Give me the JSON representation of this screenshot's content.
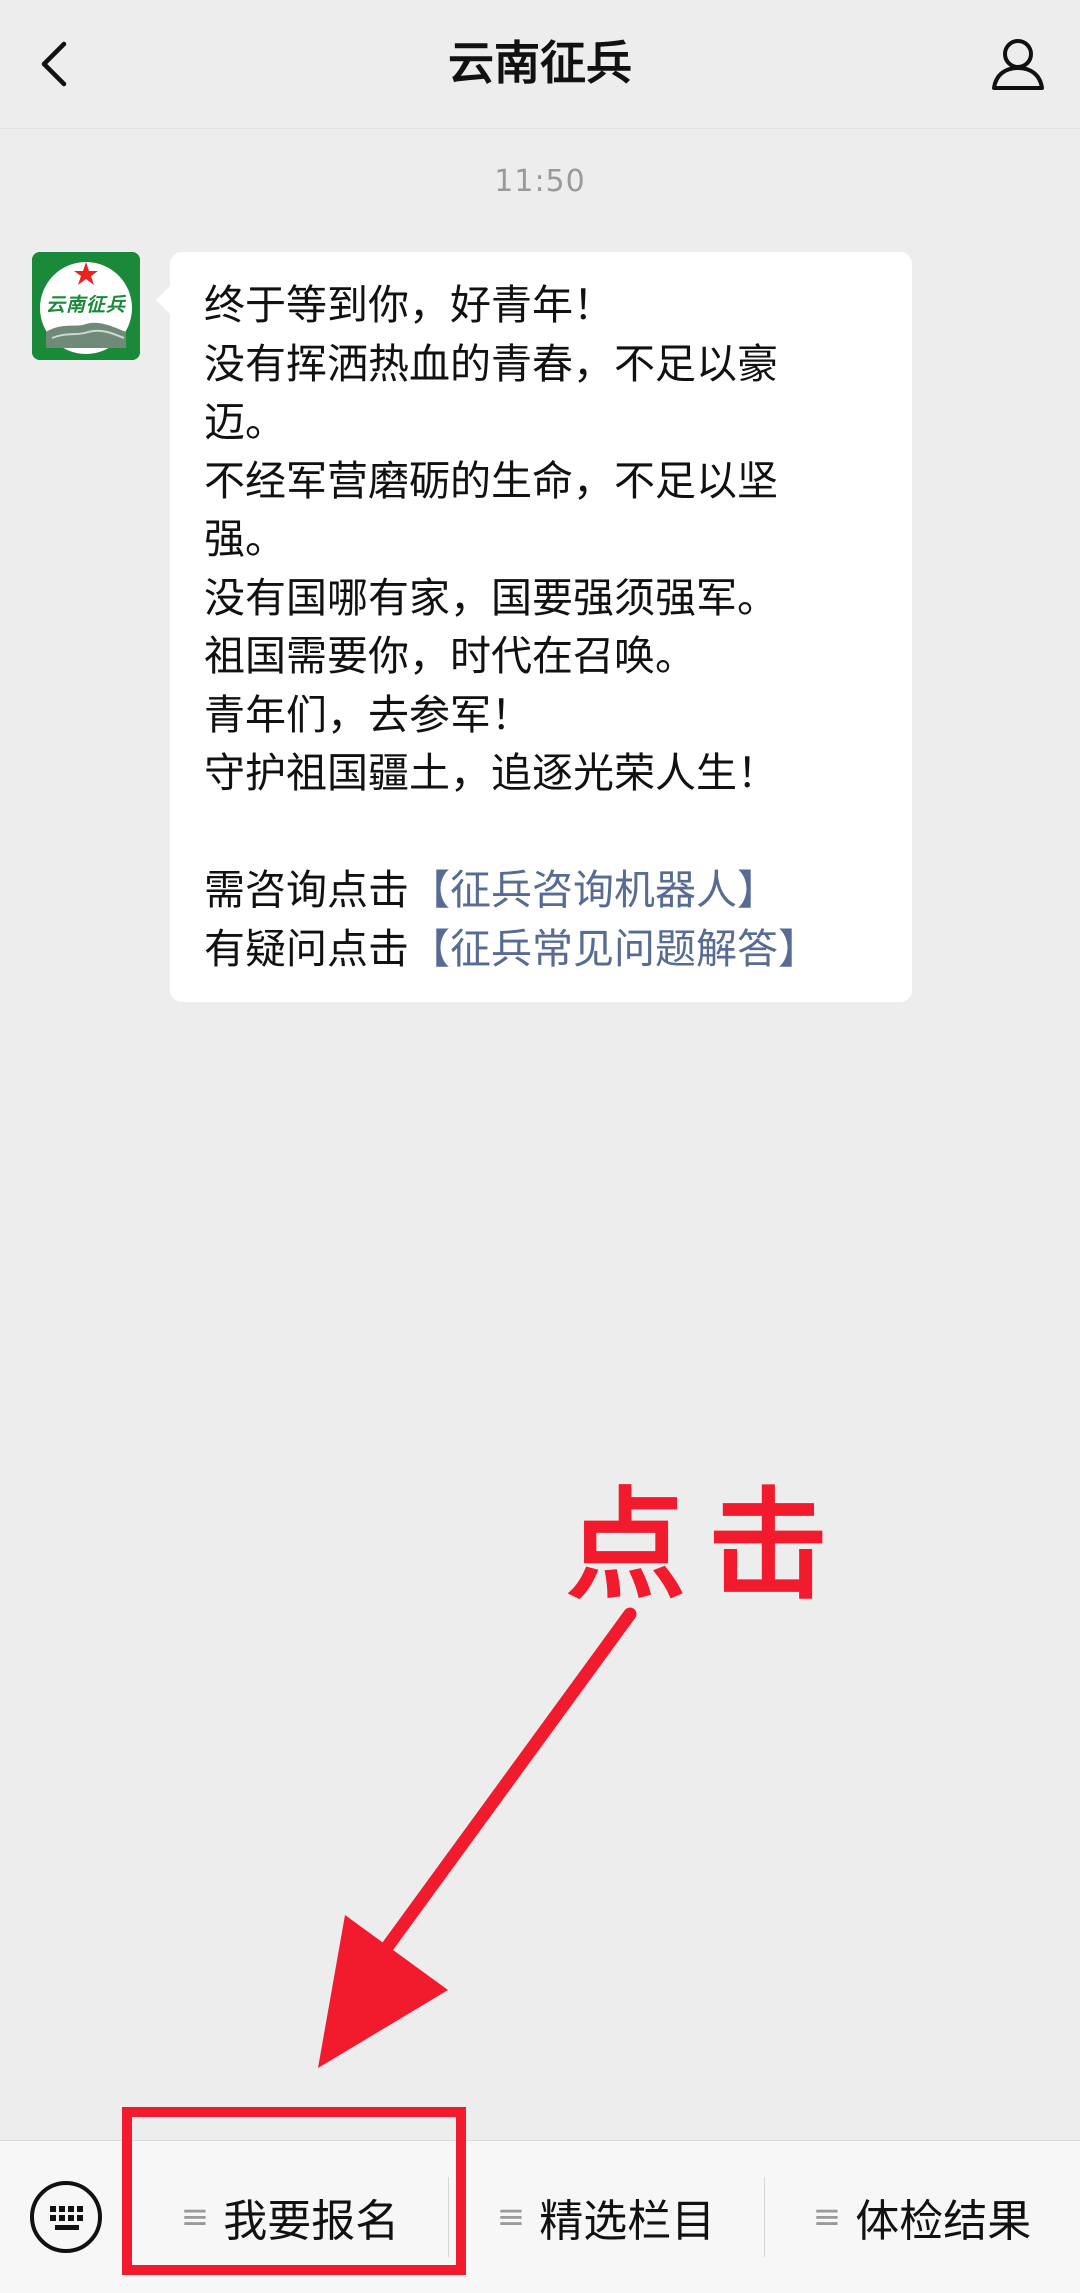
{
  "header": {
    "title": "云南征兵",
    "back_icon": "chevron-left-icon",
    "profile_icon": "person-icon"
  },
  "chat": {
    "timestamp": "11:50",
    "avatar": {
      "icon": "yunnan-recruitment-logo",
      "logo_text": "云南征兵",
      "colors": {
        "primary": "#1a8a3a",
        "star": "#e8241c"
      }
    },
    "message": {
      "lines": [
        "终于等到你，好青年！",
        "没有挥洒热血的青春，不足以豪",
        "迈。",
        "不经军营磨砺的生命，不足以坚",
        "强。",
        "没有国哪有家，国要强须强军。",
        "祖国需要你，时代在召唤。",
        "青年们，去参军！",
        "守护祖国疆土，追逐光荣人生！"
      ],
      "consult_prefix": "需咨询点击",
      "consult_link": "【征兵咨询机器人】",
      "faq_prefix": "有疑问点击",
      "faq_link": "【征兵常见问题解答】",
      "link_color": "#576b95"
    }
  },
  "annotation": {
    "text": "点击",
    "color": "#f21b2d"
  },
  "bottom_menu": {
    "keyboard_icon": "keyboard-icon",
    "items": [
      {
        "label": "我要报名",
        "icon": "menu-icon"
      },
      {
        "label": "精选栏目",
        "icon": "menu-icon"
      },
      {
        "label": "体检结果",
        "icon": "menu-icon"
      }
    ]
  }
}
